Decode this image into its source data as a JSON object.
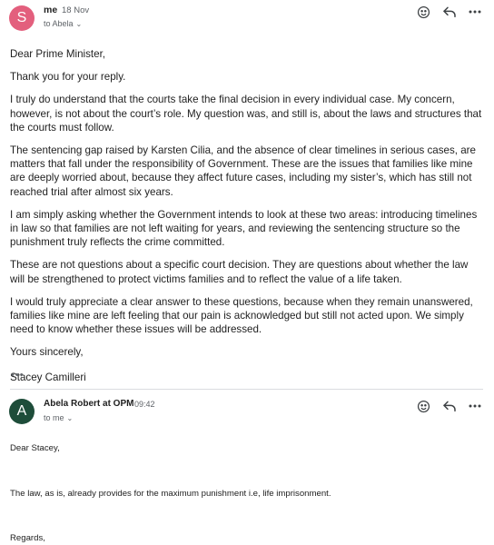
{
  "message1": {
    "avatar_letter": "S",
    "avatar_color": "#e35f7d",
    "sender": "me",
    "date": "18 Nov",
    "recipient_label": "to Abela",
    "paragraphs": [
      "Dear Prime Minister,",
      "Thank you for your reply.",
      "I truly do understand that the courts take the final decision in every individual case. My concern, however, is not about the court’s role. My question was, and still is, about the laws and structures that the courts must follow.",
      "The sentencing gap raised by Karsten Cilia, and the absence of clear timelines in serious cases, are matters that fall under the responsibility of Government. These are the issues that families like mine are deeply worried about, because they affect future cases, including my sister’s, which has still not reached trial after almost six years.",
      "I am simply asking whether the Government intends to look at these two areas: introducing timelines in law so that families are not left waiting for years, and reviewing the sentencing structure so the punishment truly reflects the crime committed.",
      "These are not questions about a specific court decision. They are questions about whether the law will be strengthened to protect victims families and to reflect the value of a life taken.",
      "I would truly appreciate a clear answer to these questions, because when they remain unanswered, families like mine are left feeling that our pain is acknowledged but still not acted upon. We simply need to know whether these issues will be addressed.",
      "Yours sincerely,",
      "Stacey Camilleri"
    ]
  },
  "quoted_ellipsis": "•••",
  "message2": {
    "avatar_letter": "A",
    "avatar_color": "#1e4d3a",
    "sender": "Abela Robert at OPM",
    "time": "09:42",
    "recipient_label": "to me",
    "greeting": "Dear Stacey,",
    "body": "The law, as is, already provides for the maximum punishment i.e, life imprisonment.",
    "closing": "Regards,"
  },
  "icons": {
    "emoji": "emoji-icon",
    "reply": "reply-icon",
    "more": "more-icon",
    "chevron": "chevron-down-icon"
  }
}
